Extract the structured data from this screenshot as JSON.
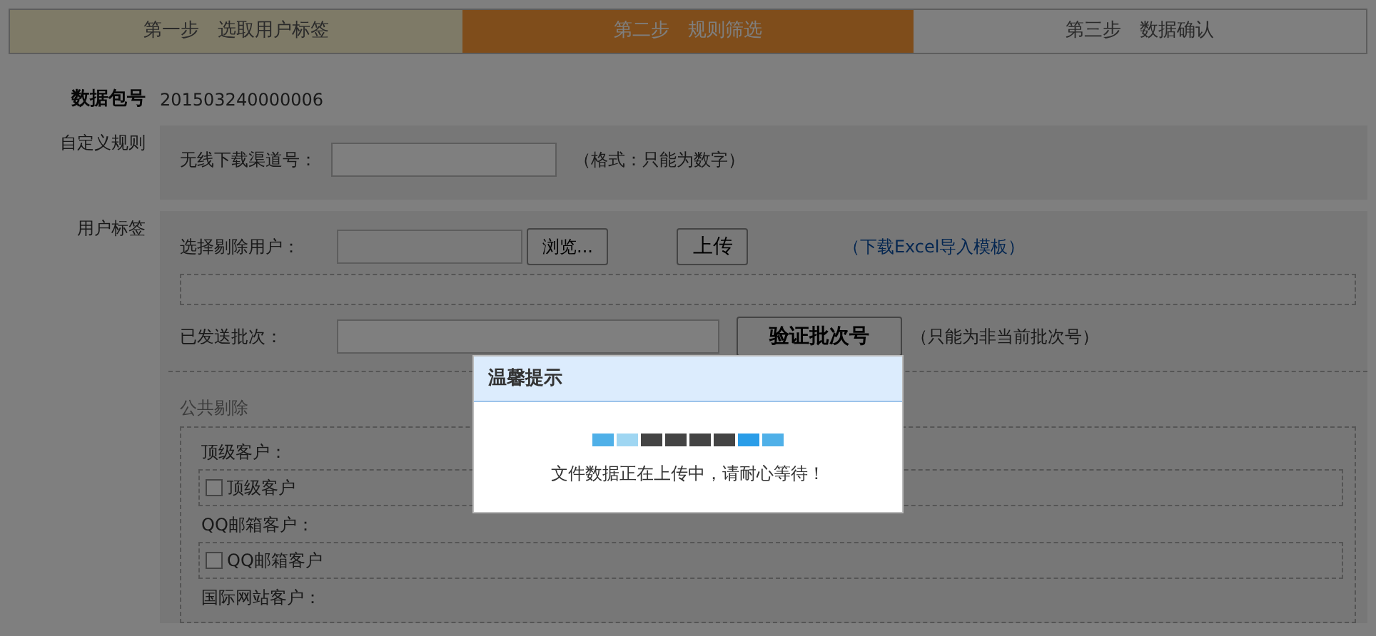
{
  "steps": [
    {
      "label": "第一步　选取用户标签",
      "selected": false,
      "done": true
    },
    {
      "label": "第二步　规则筛选",
      "selected": true,
      "done": false
    },
    {
      "label": "第三步　数据确认",
      "selected": false,
      "done": false
    }
  ],
  "package": {
    "label": "数据包号",
    "value": "201503240000006"
  },
  "custom_rules": {
    "label": "自定义规则",
    "field_label": "无线下载渠道号：",
    "hint": "（格式：只能为数字）"
  },
  "user_tags": {
    "label": "用户标签",
    "exclude_label": "选择剔除用户：",
    "browse_button": "浏览...",
    "upload_button": "上传",
    "template_link": "（下载Excel导入模板）",
    "batch_label": "已发送批次：",
    "verify_button": "验证批次号",
    "batch_hint": "（只能为非当前批次号）",
    "public_exclude": {
      "title": "公共剔除",
      "groups": [
        {
          "label": "顶级客户：",
          "option": "顶级客户",
          "checked": false
        },
        {
          "label": "QQ邮箱客户：",
          "option": "QQ邮箱客户",
          "checked": false
        },
        {
          "label": "国际网站客户："
        }
      ]
    }
  },
  "dialog": {
    "title": "温馨提示",
    "message": "文件数据正在上传中，请耐心等待！"
  }
}
